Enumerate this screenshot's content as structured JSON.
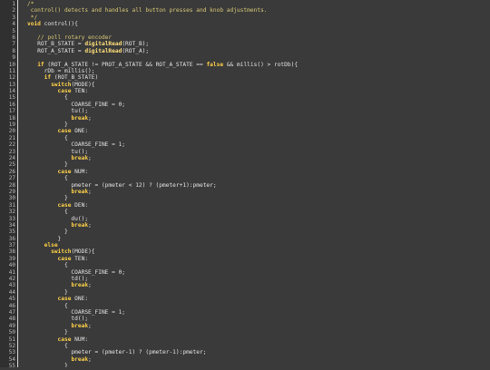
{
  "editor": {
    "lines": [
      {
        "n": "1",
        "t": [
          [
            "/*",
            "cm"
          ]
        ]
      },
      {
        "n": "2",
        "t": [
          [
            " control() detects and handles all button presses and knob adjustments.",
            "cm"
          ]
        ]
      },
      {
        "n": "3",
        "t": [
          [
            " */",
            "cm"
          ]
        ]
      },
      {
        "n": "4",
        "t": [
          [
            "void",
            "kw"
          ],
          [
            " control(){",
            "tx"
          ]
        ]
      },
      {
        "n": "5",
        "t": [
          [
            "",
            "tx"
          ]
        ]
      },
      {
        "n": "6",
        "t": [
          [
            "   // poll rotary encoder",
            "cm"
          ]
        ]
      },
      {
        "n": "7",
        "t": [
          [
            "   ROT_B_STATE = ",
            "tx"
          ],
          [
            "digitalRead",
            "fn"
          ],
          [
            "(ROT_B);",
            "tx"
          ]
        ]
      },
      {
        "n": "8",
        "t": [
          [
            "   ROT_A_STATE = ",
            "tx"
          ],
          [
            "digitalRead",
            "fn"
          ],
          [
            "(ROT_A);",
            "tx"
          ]
        ]
      },
      {
        "n": "9",
        "t": [
          [
            "",
            "tx"
          ]
        ]
      },
      {
        "n": "10",
        "t": [
          [
            "   ",
            "tx"
          ],
          [
            "if",
            "kw"
          ],
          [
            " (ROT_A_STATE != PROT_A_STATE && ROT_A_STATE == ",
            "tx"
          ],
          [
            "false",
            "kw"
          ],
          [
            " && millis() > rotDb){",
            "tx"
          ]
        ]
      },
      {
        "n": "11",
        "t": [
          [
            "     rDb = millis();",
            "tx"
          ]
        ]
      },
      {
        "n": "12",
        "t": [
          [
            "     ",
            "tx"
          ],
          [
            "if",
            "kw"
          ],
          [
            " (ROT_B_STATE)",
            "tx"
          ]
        ]
      },
      {
        "n": "13",
        "t": [
          [
            "       ",
            "tx"
          ],
          [
            "switch",
            "kw"
          ],
          [
            "(MODE){",
            "tx"
          ]
        ]
      },
      {
        "n": "14",
        "t": [
          [
            "         ",
            "tx"
          ],
          [
            "case",
            "kw"
          ],
          [
            " TEN:",
            "tx"
          ]
        ]
      },
      {
        "n": "15",
        "t": [
          [
            "           {",
            "tx"
          ]
        ]
      },
      {
        "n": "16",
        "t": [
          [
            "             COARSE_FINE = 0;",
            "tx"
          ]
        ]
      },
      {
        "n": "17",
        "t": [
          [
            "             tu();",
            "tx"
          ]
        ]
      },
      {
        "n": "18",
        "t": [
          [
            "             ",
            "tx"
          ],
          [
            "break",
            "kw"
          ],
          [
            ";",
            "tx"
          ]
        ]
      },
      {
        "n": "19",
        "t": [
          [
            "           }",
            "tx"
          ]
        ]
      },
      {
        "n": "20",
        "t": [
          [
            "         ",
            "tx"
          ],
          [
            "case",
            "kw"
          ],
          [
            " ONE:",
            "tx"
          ]
        ]
      },
      {
        "n": "21",
        "t": [
          [
            "           {",
            "tx"
          ]
        ]
      },
      {
        "n": "22",
        "t": [
          [
            "             COARSE_FINE = 1;",
            "tx"
          ]
        ]
      },
      {
        "n": "23",
        "t": [
          [
            "             tu();",
            "tx"
          ]
        ]
      },
      {
        "n": "24",
        "t": [
          [
            "             ",
            "tx"
          ],
          [
            "break",
            "kw"
          ],
          [
            ";",
            "tx"
          ]
        ]
      },
      {
        "n": "25",
        "t": [
          [
            "           }",
            "tx"
          ]
        ]
      },
      {
        "n": "26",
        "t": [
          [
            "         ",
            "tx"
          ],
          [
            "case",
            "kw"
          ],
          [
            " NUM:",
            "tx"
          ]
        ]
      },
      {
        "n": "27",
        "t": [
          [
            "           {",
            "tx"
          ]
        ]
      },
      {
        "n": "28",
        "t": [
          [
            "             pmeter = (pmeter < 12) ? (pmeter+1):pmeter;",
            "tx"
          ]
        ]
      },
      {
        "n": "29",
        "t": [
          [
            "             ",
            "tx"
          ],
          [
            "break",
            "kw"
          ],
          [
            ";",
            "tx"
          ]
        ]
      },
      {
        "n": "30",
        "t": [
          [
            "           }",
            "tx"
          ]
        ]
      },
      {
        "n": "31",
        "t": [
          [
            "         ",
            "tx"
          ],
          [
            "case",
            "kw"
          ],
          [
            " DEN:",
            "tx"
          ]
        ]
      },
      {
        "n": "32",
        "t": [
          [
            "           {",
            "tx"
          ]
        ]
      },
      {
        "n": "33",
        "t": [
          [
            "             du();",
            "tx"
          ]
        ]
      },
      {
        "n": "34",
        "t": [
          [
            "             ",
            "tx"
          ],
          [
            "break",
            "kw"
          ],
          [
            ";",
            "tx"
          ]
        ]
      },
      {
        "n": "35",
        "t": [
          [
            "           }",
            "tx"
          ]
        ]
      },
      {
        "n": "36",
        "t": [
          [
            "         }",
            "tx"
          ]
        ]
      },
      {
        "n": "37",
        "t": [
          [
            "     ",
            "tx"
          ],
          [
            "else",
            "kw"
          ]
        ]
      },
      {
        "n": "38",
        "t": [
          [
            "       ",
            "tx"
          ],
          [
            "switch",
            "kw"
          ],
          [
            "(MODE){",
            "tx"
          ]
        ]
      },
      {
        "n": "39",
        "t": [
          [
            "         ",
            "tx"
          ],
          [
            "case",
            "kw"
          ],
          [
            " TEN:",
            "tx"
          ]
        ]
      },
      {
        "n": "40",
        "t": [
          [
            "           {",
            "tx"
          ]
        ]
      },
      {
        "n": "41",
        "t": [
          [
            "             COARSE_FINE = 0;",
            "tx"
          ]
        ]
      },
      {
        "n": "42",
        "t": [
          [
            "             td();",
            "tx"
          ]
        ]
      },
      {
        "n": "43",
        "t": [
          [
            "             ",
            "tx"
          ],
          [
            "break",
            "kw"
          ],
          [
            ";",
            "tx"
          ]
        ]
      },
      {
        "n": "44",
        "t": [
          [
            "           }",
            "tx"
          ]
        ]
      },
      {
        "n": "45",
        "t": [
          [
            "         ",
            "tx"
          ],
          [
            "case",
            "kw"
          ],
          [
            " ONE:",
            "tx"
          ]
        ]
      },
      {
        "n": "46",
        "t": [
          [
            "           {",
            "tx"
          ]
        ]
      },
      {
        "n": "47",
        "t": [
          [
            "             COARSE_FINE = 1;",
            "tx"
          ]
        ]
      },
      {
        "n": "48",
        "t": [
          [
            "             td();",
            "tx"
          ]
        ]
      },
      {
        "n": "49",
        "t": [
          [
            "             ",
            "tx"
          ],
          [
            "break",
            "kw"
          ],
          [
            ";",
            "tx"
          ]
        ]
      },
      {
        "n": "50",
        "t": [
          [
            "           }",
            "tx"
          ]
        ]
      },
      {
        "n": "51",
        "t": [
          [
            "         ",
            "tx"
          ],
          [
            "case",
            "kw"
          ],
          [
            " NUM:",
            "tx"
          ]
        ]
      },
      {
        "n": "52",
        "t": [
          [
            "           {",
            "tx"
          ]
        ]
      },
      {
        "n": "53",
        "t": [
          [
            "             pmeter = (pmeter-1) ? (pmeter-1):pmeter;",
            "tx"
          ]
        ]
      },
      {
        "n": "54",
        "t": [
          [
            "             ",
            "tx"
          ],
          [
            "break",
            "kw"
          ],
          [
            ";",
            "tx"
          ]
        ]
      },
      {
        "n": "55",
        "t": [
          [
            "           }",
            "tx"
          ]
        ]
      }
    ]
  },
  "colors": {
    "background": "#3a3a3a",
    "gutter": "#303030",
    "comment": "#d8c878",
    "keyword": "#ffd24a",
    "text": "#e4e4e4"
  }
}
